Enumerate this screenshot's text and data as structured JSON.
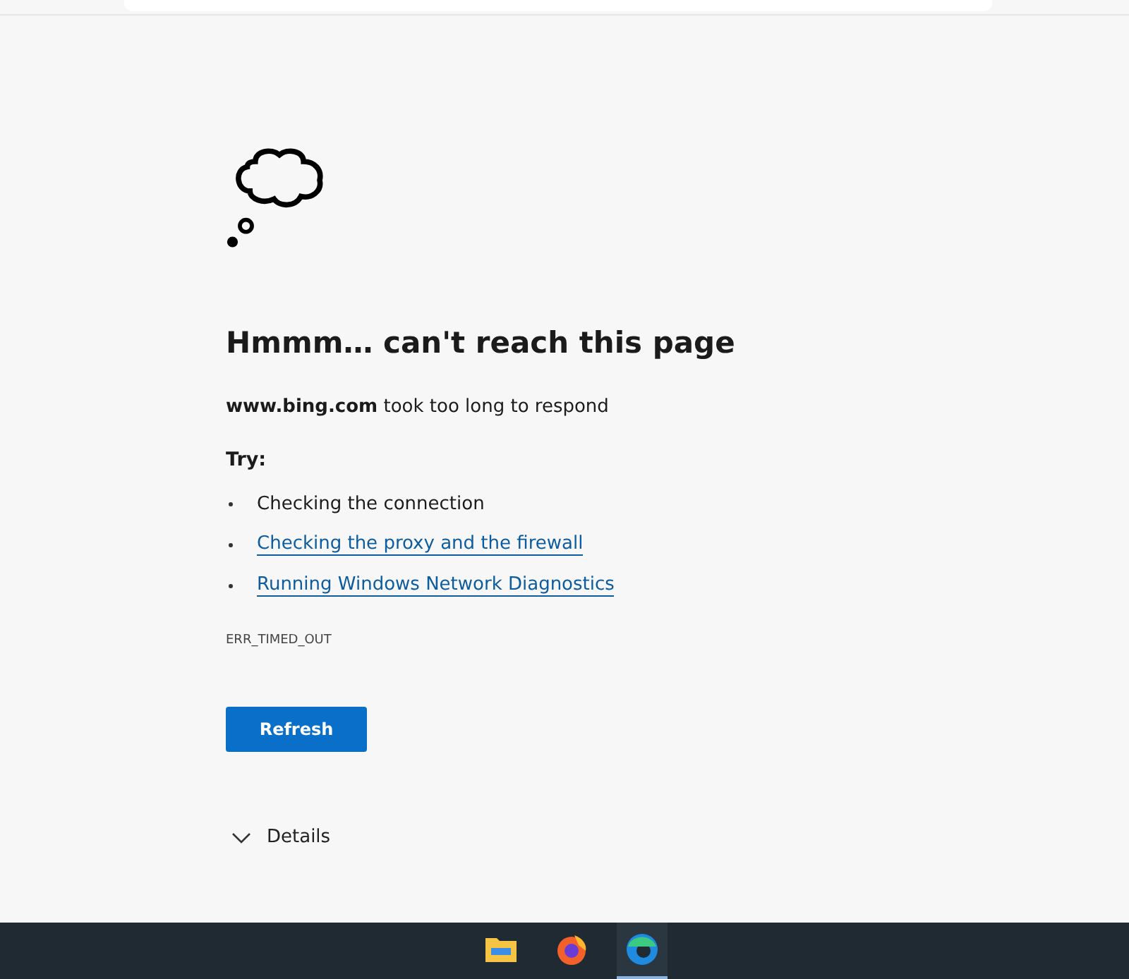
{
  "error_page": {
    "heading": "Hmmm… can't reach this page",
    "message": "**www.bing.com** took too long to respond",
    "try_label": "Try:",
    "suggestions": [
      {
        "text": "Checking the connection",
        "kind": "plain"
      },
      {
        "text": "Checking the proxy and the firewall",
        "kind": "link"
      },
      {
        "text": "Running Windows Network Diagnostics",
        "kind": "link"
      }
    ],
    "error_code": "ERR_TIMED_OUT",
    "refresh_button": "Refresh",
    "details": {
      "label": "Details",
      "expanded": false
    }
  },
  "taskbar": {
    "apps": [
      {
        "kind": "folder",
        "selected": false
      },
      {
        "kind": "firefox",
        "selected": false
      },
      {
        "kind": "edge",
        "selected": true
      }
    ]
  }
}
